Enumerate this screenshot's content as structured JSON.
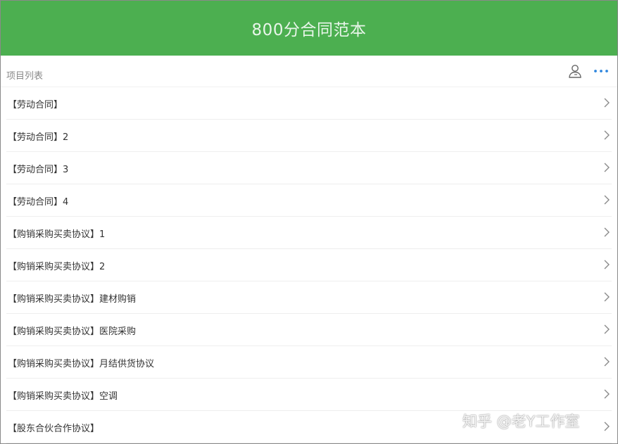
{
  "header": {
    "title": "800分合同范本"
  },
  "subbar": {
    "label": "项目列表",
    "icons": [
      "user-icon",
      "more-icon"
    ]
  },
  "list": {
    "items": [
      {
        "label": "【劳动合同】"
      },
      {
        "label": "【劳动合同】2"
      },
      {
        "label": "【劳动合同】3"
      },
      {
        "label": "【劳动合同】4"
      },
      {
        "label": "【购销采购买卖协议】1"
      },
      {
        "label": "【购销采购买卖协议】2"
      },
      {
        "label": "【购销采购买卖协议】建材购销"
      },
      {
        "label": "【购销采购买卖协议】医院采购"
      },
      {
        "label": "【购销采购买卖协议】月结供货协议"
      },
      {
        "label": "【购销采购买卖协议】空调"
      },
      {
        "label": "【股东合伙合作协议】"
      }
    ]
  },
  "watermark": {
    "text": "知乎 @老Y工作室"
  },
  "colors": {
    "header_bg": "#4caf50",
    "header_text": "#e8f5e9",
    "accent_blue": "#2e86de",
    "text_primary": "#333333",
    "text_secondary": "#8a8a8a",
    "divider": "#eeeeee"
  }
}
